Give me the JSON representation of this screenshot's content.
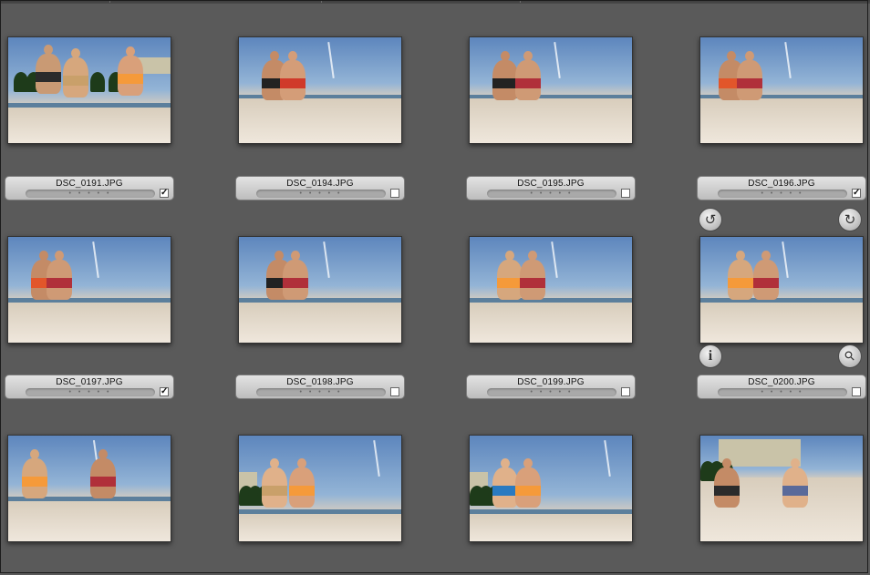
{
  "photos": [
    {
      "name": "DSC_0191.JPG",
      "rating": "• • • • •",
      "checked": true
    },
    {
      "name": "DSC_0194.JPG",
      "rating": "• • • • •",
      "checked": false
    },
    {
      "name": "DSC_0195.JPG",
      "rating": "• • • • •",
      "checked": false
    },
    {
      "name": "DSC_0196.JPG",
      "rating": "• • • • •",
      "checked": true
    },
    {
      "name": "DSC_0197.JPG",
      "rating": "• • • • •",
      "checked": true
    },
    {
      "name": "DSC_0198.JPG",
      "rating": "• • • • •",
      "checked": false
    },
    {
      "name": "DSC_0199.JPG",
      "rating": "• • • • •",
      "checked": false
    },
    {
      "name": "DSC_0200.JPG",
      "rating": "• • • • •",
      "checked": false
    },
    {
      "name": "",
      "rating": "",
      "checked": false
    },
    {
      "name": "",
      "rating": "",
      "checked": false
    },
    {
      "name": "",
      "rating": "",
      "checked": false
    },
    {
      "name": "",
      "rating": "",
      "checked": false
    }
  ],
  "check_glyph": "✓",
  "overlay_buttons": {
    "rotate_left_icon": "↺",
    "rotate_right_icon": "↻",
    "info_icon": "i",
    "loupe_icon": "⚲"
  },
  "colors": {
    "background": "#5a5a5a",
    "sky": "#6f9ac9",
    "sand": "#e6ddd0"
  }
}
